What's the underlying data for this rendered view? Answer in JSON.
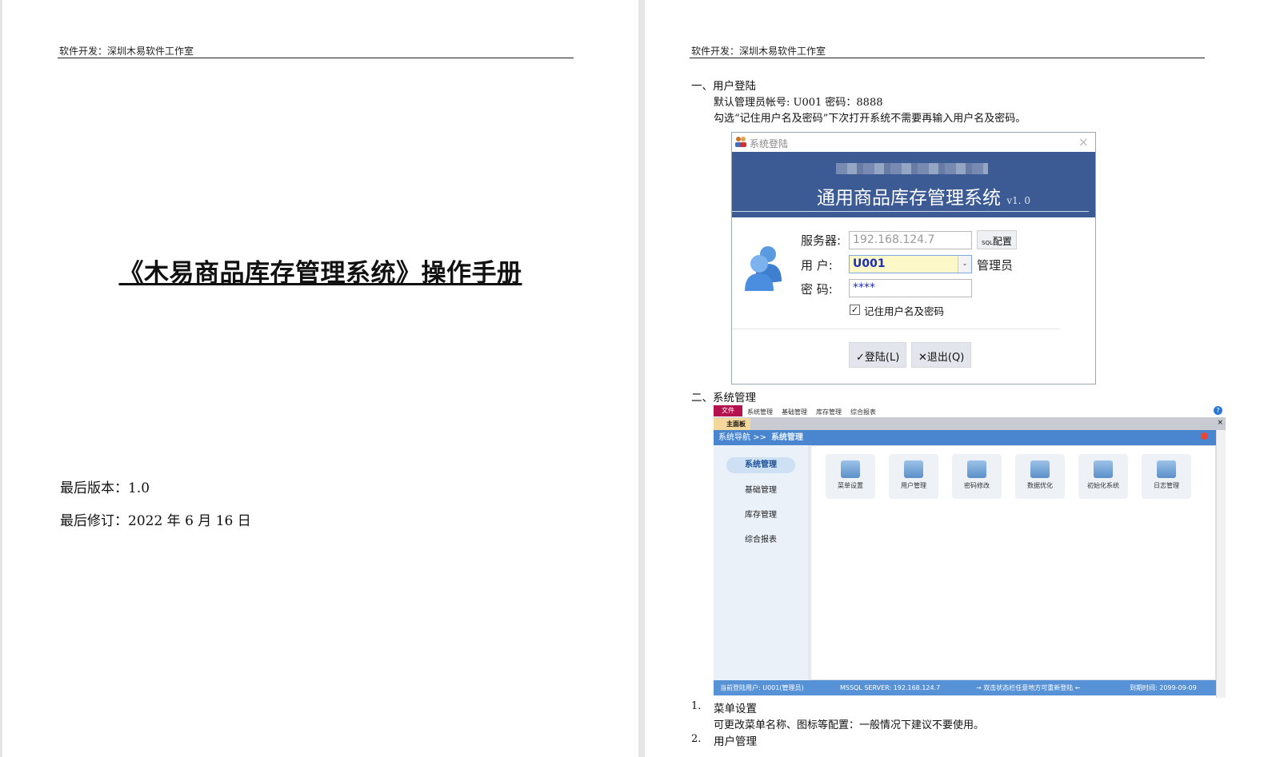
{
  "left_page": {
    "header": "软件开发：深圳木易软件工作室",
    "title": "《木易商品库存管理系统》操作手册",
    "version": "最后版本：1.0",
    "revision": "最后修订：2022 年 6 月 16 日"
  },
  "right_page": {
    "header": "软件开发：深圳木易软件工作室",
    "section1": {
      "heading": "一、用户登陆",
      "line1": "默认管理员帐号: U001 密码：8888",
      "line2": "勾选“记住用户名及密码”下次打开系统不需要再输入用户名及密码。"
    },
    "login_dialog": {
      "window_title": "系统登陆",
      "banner_title": "通用商品库存管理系统",
      "banner_version": "v1. 0",
      "server_label": "服务器:",
      "server_value": "192.168.124.7",
      "sql_config": "配置",
      "sql_prefix": "SQL",
      "user_label": "用 户:",
      "user_value": "U001",
      "user_role": "管理员",
      "password_label": "密 码:",
      "password_value": "****",
      "remember_label": "记住用户名及密码",
      "remember_checked": true,
      "login_button": "✓登陆(L)",
      "exit_button": "✕退出(Q)"
    },
    "section2": {
      "heading": "二、系统管理"
    },
    "app_window": {
      "menu_file": "文件",
      "menus": [
        "系统管理",
        "基础管理",
        "库存管理",
        "综合报表"
      ],
      "tab_label": "主面板",
      "nav_prefix": "系统导航 >>",
      "nav_current": "系统管理",
      "sidebar": [
        {
          "label": "系统管理",
          "active": true
        },
        {
          "label": "基础管理",
          "active": false
        },
        {
          "label": "库存管理",
          "active": false
        },
        {
          "label": "综合报表",
          "active": false
        }
      ],
      "tiles": [
        "菜单设置",
        "用户管理",
        "密码修改",
        "数据优化",
        "初始化系统",
        "日志管理"
      ],
      "status": {
        "user": "当前登陆用户: U001(管理员)",
        "server": "MSSQL SERVER:   192.168.124.7",
        "hint": "→ 双击状态栏任意地方可重新登陆 ←",
        "expiry": "到期时间: 2099-09-09"
      }
    },
    "list": [
      {
        "num": "1.",
        "title": "菜单设置",
        "desc": "可更改菜单名称、图标等配置：一般情况下建议不要使用。"
      },
      {
        "num": "2.",
        "title": "用户管理"
      }
    ]
  }
}
